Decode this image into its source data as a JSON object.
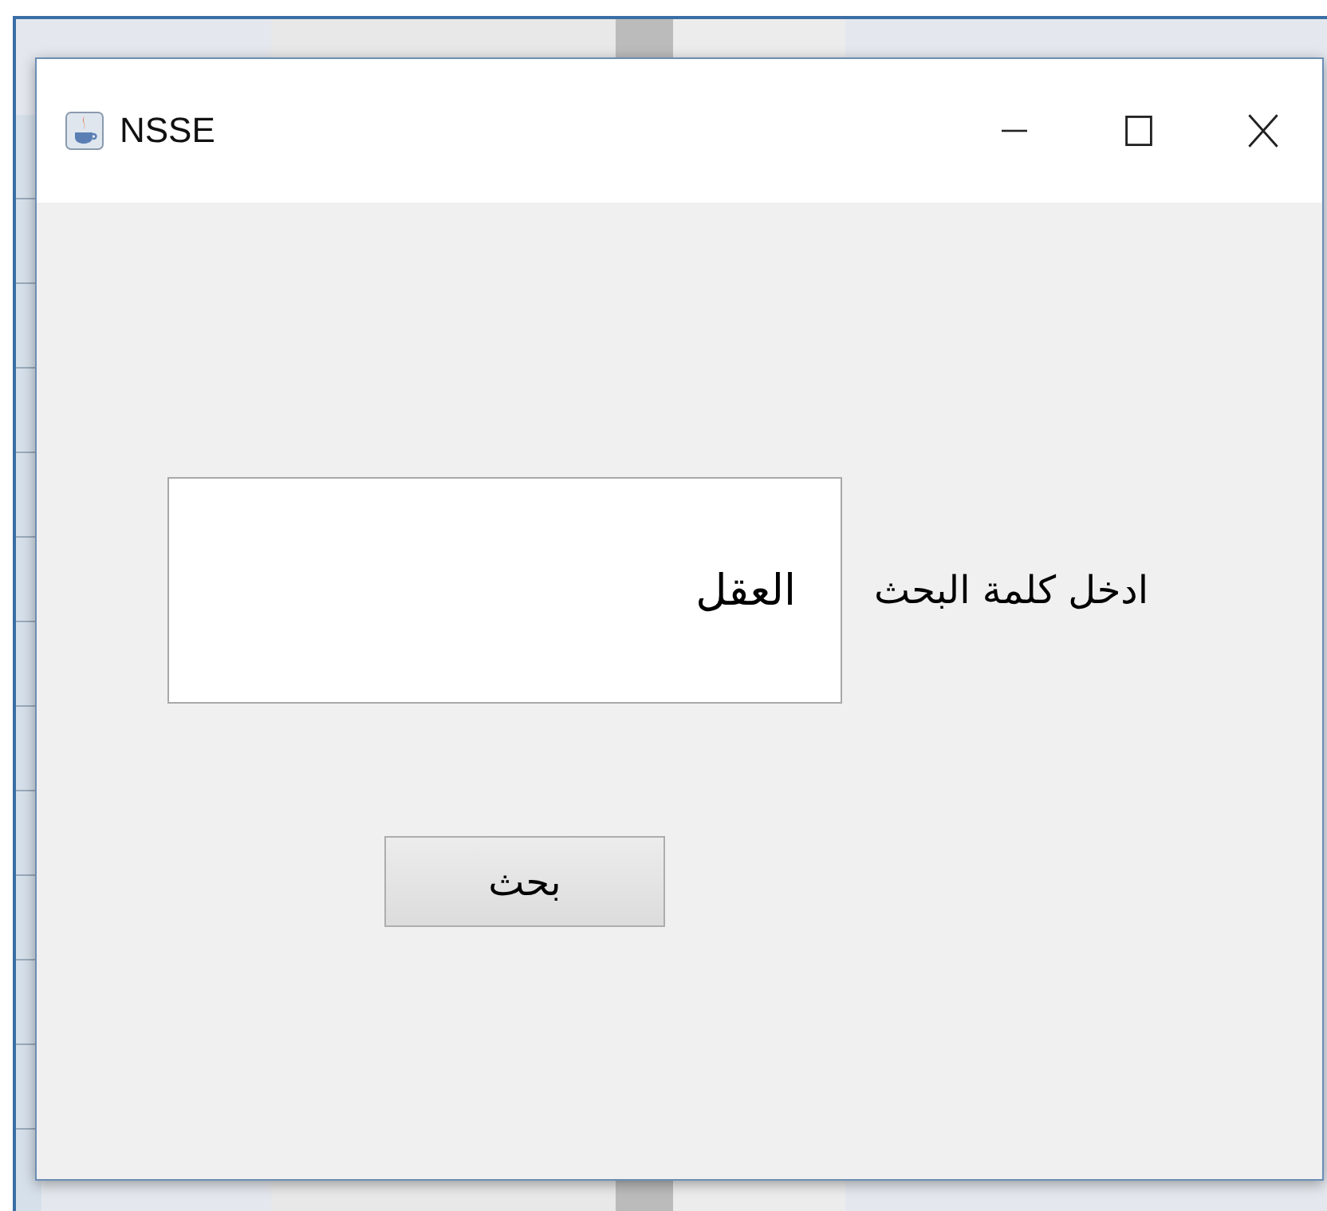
{
  "window": {
    "title": "NSSE"
  },
  "search": {
    "label": "ادخل كلمة البحث",
    "value": "العقل"
  },
  "buttons": [
    {
      "label": "بحث"
    }
  ]
}
